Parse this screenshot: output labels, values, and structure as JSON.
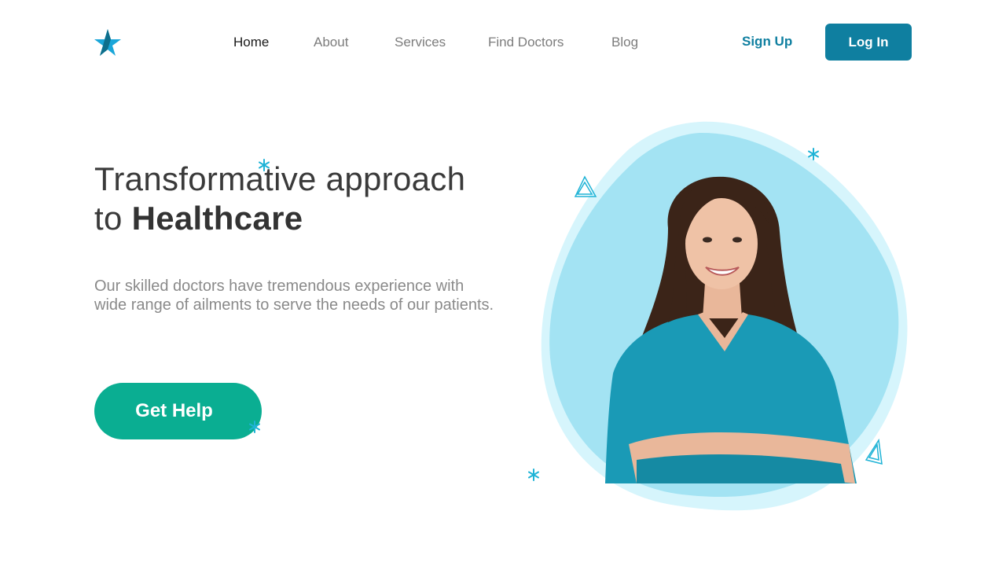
{
  "brand": {
    "logo_icon": "star-logo-icon",
    "accent": "#0f7fa0",
    "logo_color": "#1aa6d9"
  },
  "nav": {
    "items": [
      {
        "label": "Home",
        "active": true
      },
      {
        "label": "About",
        "active": false
      },
      {
        "label": "Services",
        "active": false
      },
      {
        "label": "Find Doctors",
        "active": false
      },
      {
        "label": "Blog",
        "active": false
      }
    ],
    "signup_label": "Sign Up",
    "login_label": "Log In"
  },
  "hero": {
    "title_line1": "Transformative approach",
    "title_line2_prefix": "to ",
    "title_line2_bold": "Healthcare",
    "description": "Our skilled doctors have tremendous experience with wide range of ailments to serve the needs of our patients.",
    "cta_label": "Get Help",
    "cta_color": "#0aae92",
    "image": "smiling-female-doctor-in-teal-scrubs-with-crossed-arms",
    "blob_outer_color": "#d6f5fc",
    "blob_inner_color": "#a3e3f3"
  }
}
